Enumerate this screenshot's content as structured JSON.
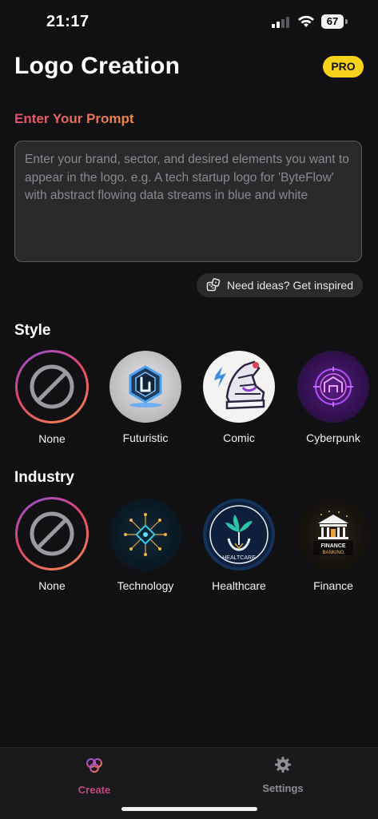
{
  "status": {
    "time": "21:17",
    "battery": "67"
  },
  "header": {
    "title": "Logo Creation",
    "pro_badge": "PRO"
  },
  "prompt": {
    "label": "Enter Your Prompt",
    "placeholder": "Enter your brand, sector, and desired elements you want to appear in the logo. e.g. A tech startup logo for 'ByteFlow' with abstract flowing data streams in blue and white",
    "value": ""
  },
  "inspire": {
    "label": "Need ideas? Get inspired",
    "icon": "dice-icon"
  },
  "style": {
    "title": "Style",
    "items": [
      {
        "label": "None",
        "icon": "none-icon"
      },
      {
        "label": "Futuristic"
      },
      {
        "label": "Comic"
      },
      {
        "label": "Cyberpunk"
      }
    ]
  },
  "industry": {
    "title": "Industry",
    "items": [
      {
        "label": "None",
        "icon": "none-icon"
      },
      {
        "label": "Technology"
      },
      {
        "label": "Healthcare",
        "image_text": "HEALTCARE"
      },
      {
        "label": "Finance",
        "image_text_1": "FINANCE",
        "image_text_2": "BANKING"
      }
    ]
  },
  "tabs": [
    {
      "label": "Create",
      "icon": "create-icon",
      "active": true,
      "color": "#c2477f"
    },
    {
      "label": "Settings",
      "icon": "gear-icon",
      "active": false,
      "color": "#8e8e93"
    }
  ],
  "colors": {
    "accent": "#f7d21b",
    "background": "#111113",
    "prompt_gradient_start": "#e2506b",
    "prompt_gradient_end": "#f08a4b"
  }
}
